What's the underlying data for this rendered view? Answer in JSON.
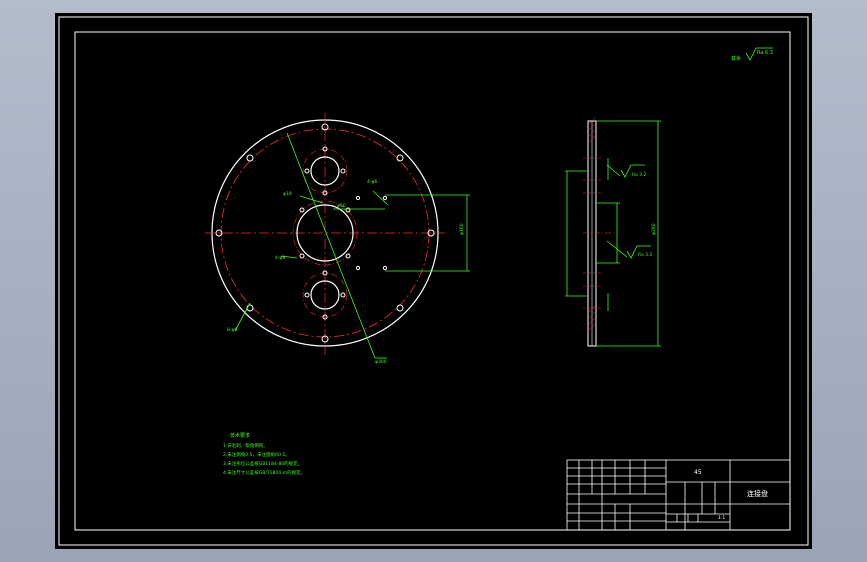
{
  "title_block": {
    "material": "45",
    "part_name": "连接盘",
    "scale": "1:1"
  },
  "tech_notes": {
    "heading": "技术要求",
    "lines": [
      "1.去毛刺，锐角倒钝。",
      "2.未注倒角0.5，未注圆角R0.5。",
      "3.未注形位公差按GB1184-80的规定。",
      "4.未注尺寸公差按GB/T1804-m的规定。"
    ]
  },
  "roughness": {
    "other": "其余",
    "ra_main": "Ra 6.3",
    "ra_side_1": "Ra 3.2",
    "ra_side_2": "Ra 3.2"
  },
  "labels": {
    "hole_tag_1": "4-φ6",
    "hole_tag_2": "4-φ8",
    "hole_tag_3": "8-φ9",
    "center_dim": "φ50",
    "center_dim_2": "φ18",
    "bottom_tag": "φ300",
    "side_dim_1": "φ160",
    "side_dim_2": "φ280"
  },
  "colors": {
    "line": "#ffffff",
    "dim": "#39ff14",
    "center": "#ff2a2a"
  }
}
